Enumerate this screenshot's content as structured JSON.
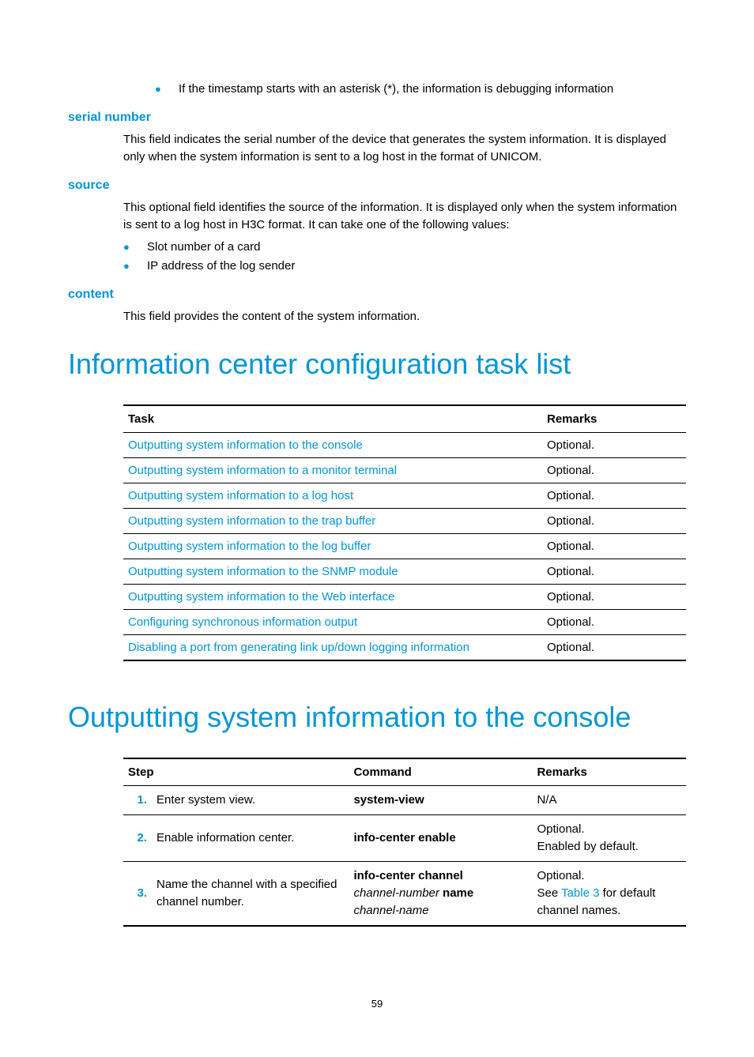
{
  "bullets_top": [
    "If the timestamp starts with an asterisk (*), the information is debugging information"
  ],
  "serial": {
    "heading": "serial number",
    "body": "This field indicates the serial number of the device that generates the system information. It is displayed only when the system information is sent to a log host in the format of UNICOM."
  },
  "source": {
    "heading": "source",
    "body": "This optional field identifies the source of the information. It is displayed only when the system information is sent to a log host in H3C format. It can take one of the following values:",
    "items": [
      "Slot number of a card",
      "IP address of the log sender"
    ]
  },
  "content_section": {
    "heading": "content",
    "body": "This field provides the content of the system information."
  },
  "h1_tasklist": "Information center configuration task list",
  "task_table": {
    "headers": [
      "Task",
      "Remarks"
    ],
    "rows": [
      [
        "Outputting system information to the console",
        "Optional."
      ],
      [
        "Outputting system information to a monitor terminal",
        "Optional."
      ],
      [
        "Outputting system information to a log host",
        "Optional."
      ],
      [
        "Outputting system information to the trap buffer",
        "Optional."
      ],
      [
        "Outputting system information to the log buffer",
        "Optional."
      ],
      [
        "Outputting system information to the SNMP module",
        "Optional."
      ],
      [
        "Outputting system information to the Web interface",
        "Optional."
      ],
      [
        "Configuring synchronous information output",
        "Optional."
      ],
      [
        "Disabling a port from generating link up/down logging information",
        "Optional."
      ]
    ]
  },
  "h1_output": "Outputting system information to the console",
  "step_table": {
    "headers": [
      "Step",
      "Command",
      "Remarks"
    ],
    "rows": [
      {
        "num": "1.",
        "step": "Enter system view.",
        "command": [
          {
            "t": "system-view",
            "b": true
          }
        ],
        "remarks_plain": "N/A"
      },
      {
        "num": "2.",
        "step": "Enable information center.",
        "command": [
          {
            "t": "info-center enable",
            "b": true
          }
        ],
        "remarks_lines": [
          "Optional.",
          "Enabled by default."
        ]
      },
      {
        "num": "3.",
        "step": "Name the channel with a specified channel number.",
        "command": [
          {
            "t": "info-center channel",
            "b": true
          },
          {
            "t": "channel-number",
            "i": true
          },
          {
            "t": " ",
            "b": false
          },
          {
            "t": "name",
            "b": true
          },
          {
            "t": "channel-name",
            "i": true
          }
        ],
        "remarks_mixed": {
          "line1": "Optional.",
          "pre": "See ",
          "link": "Table 3",
          "post": " for default channel names."
        }
      }
    ]
  },
  "page_number": "59"
}
